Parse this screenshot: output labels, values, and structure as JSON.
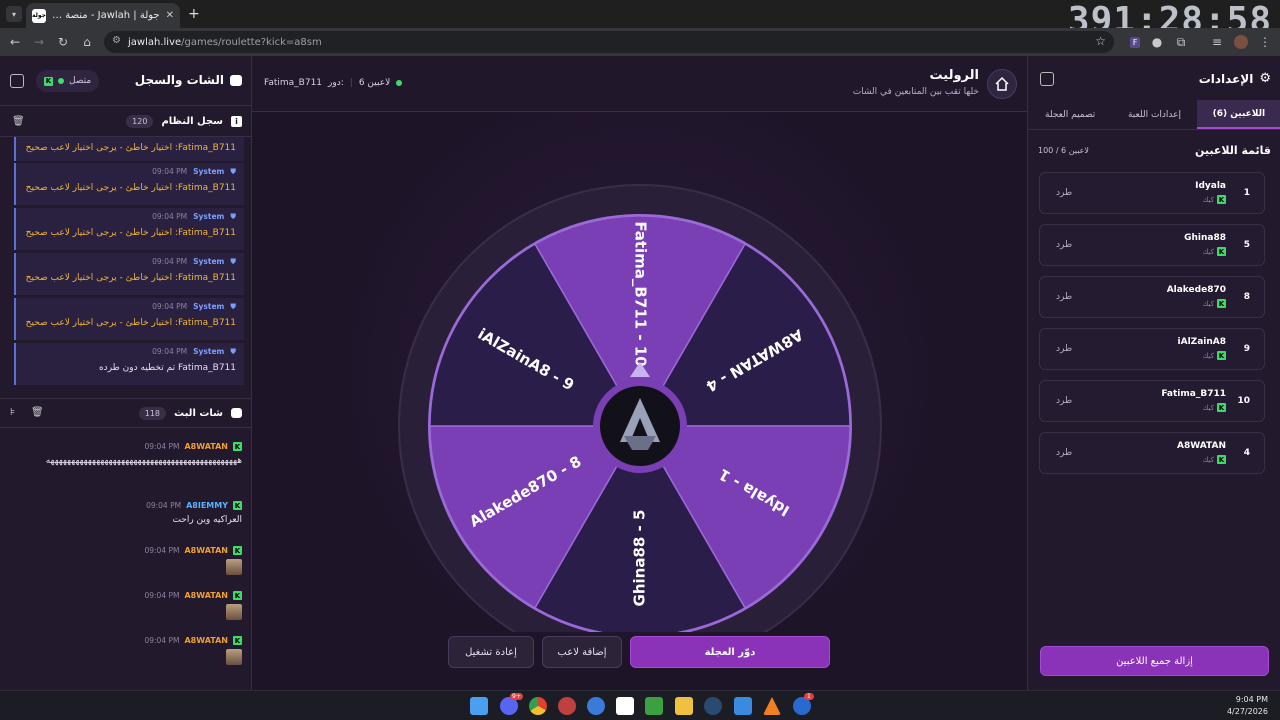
{
  "browser": {
    "tab_title": "جولة | Jawlah - منصة الألعاب الت...",
    "tab_favicon_text": "جولة",
    "url_host": "jawlah.live",
    "url_path": "/games/roulette?kick=a8sm",
    "overlay_timer": "391:28:58"
  },
  "chat": {
    "title": "الشات والسجل",
    "status": "متصل",
    "system_log": {
      "title": "سجل النظام",
      "count": "120"
    },
    "system_messages": [
      {
        "time": "09:04 PM",
        "sender": "System",
        "text": "Fatima_B711: اختيار خاطئ - يرجى اختيار لاعب صحيح",
        "color": "#f0b63a"
      },
      {
        "time": "09:04 PM",
        "sender": "System",
        "text": "Fatima_B711: اختيار خاطئ - يرجى اختيار لاعب صحيح",
        "color": "#f0b63a"
      },
      {
        "time": "09:04 PM",
        "sender": "System",
        "text": "Fatima_B711: اختيار خاطئ - يرجى اختيار لاعب صحيح",
        "color": "#f0b63a"
      },
      {
        "time": "09:04 PM",
        "sender": "System",
        "text": "Fatima_B711: اختيار خاطئ - يرجى اختيار لاعب صحيح",
        "color": "#f0b63a"
      },
      {
        "time": "09:04 PM",
        "sender": "System",
        "text": "Fatima_B711 تم تخطيه دون طرده",
        "color": "#e6e0ee"
      }
    ],
    "partial_top_message": "Fatima_B711: اختيار خاطئ - يرجى اختيار لاعب صحيح",
    "stream_chat": {
      "title": "شات البث",
      "count": "118"
    },
    "stream_messages": [
      {
        "time": "09:04 PM",
        "user": "A8WATAN",
        "text": "ههههههههههههههههههههههههههههههههههههههههههههههه",
        "emote": false
      },
      {
        "time": "09:04 PM",
        "user": "A8IEMMY",
        "text": "العراكيه وين راحت",
        "emote": false
      },
      {
        "time": "09:04 PM",
        "user": "A8WATAN",
        "text": "",
        "emote": true
      },
      {
        "time": "09:04 PM",
        "user": "A8WATAN",
        "text": "",
        "emote": true
      },
      {
        "time": "09:04 PM",
        "user": "A8WATAN",
        "text": "",
        "emote": true
      }
    ]
  },
  "game": {
    "title": "الروليت",
    "subtitle": "خلها تقب بين المتابعين في الشات",
    "players_count": "6 لاعبين",
    "turn_label": "دور:",
    "turn_player": "Fatima_B711",
    "wheel_segments": [
      {
        "label": "Fatima_B711 - 10",
        "color": "#7a3fb4"
      },
      {
        "label": "A8WATAN - 4",
        "color": "#2b1d4a"
      },
      {
        "label": "Idyala - 1",
        "color": "#7a3fb4"
      },
      {
        "label": "Ghina88 - 5",
        "color": "#2b1d4a"
      },
      {
        "label": "Alakede870 - 8",
        "color": "#7a3fb4"
      },
      {
        "label": "iAlZainA8 - 9",
        "color": "#2b1d4a"
      }
    ],
    "spin_button": "دوّر العجلة",
    "add_player_button": "إضافة لاعب",
    "restart_button": "إعادة تشغيل"
  },
  "settings": {
    "title": "الإعدادات",
    "tabs": [
      "اللاعبين (6)",
      "إعدادات اللعبة",
      "تصميم العجلة"
    ],
    "list_title": "قائمة اللاعبين",
    "list_capacity": "100 / 6 لاعبين",
    "players": [
      {
        "rank": "1",
        "name": "Idyala",
        "platform": "كيك",
        "kick_label": "طرد"
      },
      {
        "rank": "5",
        "name": "Ghina88",
        "platform": "كيك",
        "kick_label": "طرد"
      },
      {
        "rank": "8",
        "name": "Alakede870",
        "platform": "كيك",
        "kick_label": "طرد"
      },
      {
        "rank": "9",
        "name": "iAlZainA8",
        "platform": "كيك",
        "kick_label": "طرد"
      },
      {
        "rank": "10",
        "name": "Fatima_B711",
        "platform": "كيك",
        "kick_label": "طرد"
      },
      {
        "rank": "4",
        "name": "A8WATAN",
        "platform": "كيك",
        "kick_label": "طرد"
      }
    ],
    "remove_all_button": "إزالة جميع اللاعبين"
  },
  "taskbar": {
    "time": "9:04 PM",
    "date": "4/27/2026",
    "badge_discord": "9+",
    "badge_ea": "1"
  },
  "colors": {
    "accent": "#8a32b8",
    "online": "#3ddc6a",
    "warning_text": "#f0b63a",
    "system_name": "#7aa0ff"
  }
}
